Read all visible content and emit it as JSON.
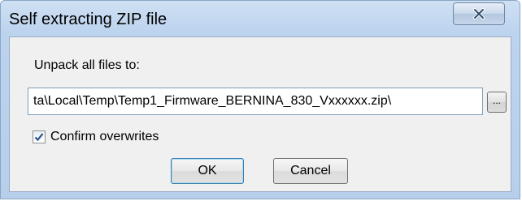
{
  "window": {
    "title": "Self extracting ZIP file"
  },
  "titlebar": {
    "close_icon": "close-icon"
  },
  "dialog": {
    "group_label": "Unpack all files to:",
    "path_value": "ta\\Local\\Temp\\Temp1_Firmware_BERNINA_830_Vxxxxxx.zip\\",
    "browse_label": "...",
    "confirm_overwrites": {
      "label": "Confirm overwrites",
      "checked": true
    },
    "ok_label": "OK",
    "cancel_label": "Cancel"
  },
  "colors": {
    "titlebar": "#bcd3ee",
    "client": "#f0f0f0",
    "check": "#2a4f8f"
  }
}
